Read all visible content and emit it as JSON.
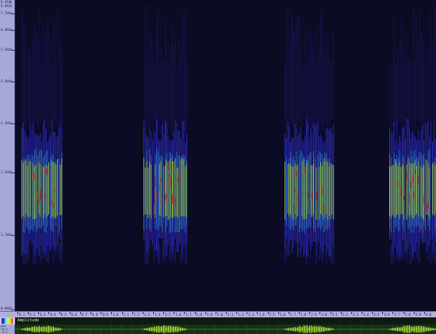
{
  "freq_axis": {
    "labels": [
      "8.910k",
      "8.8kHz",
      "7.7kHz",
      "6.6kHz",
      "5.5kHz",
      "4.4kHz",
      "3.3kHz",
      "2.2kHz",
      "1.1kHz",
      "0.0kHz"
    ]
  },
  "time_axis": {
    "labels": [
      "0.1",
      "0.2",
      "0.3",
      "0.4",
      "0.5",
      "0.6",
      "0.7",
      "0.8",
      "0.9",
      "1.0",
      "1.1",
      "1.2",
      "1.3",
      "1.4",
      "1.5",
      "1.6",
      "1.7",
      "1.8",
      "1.9",
      "2.0",
      "2.1",
      "2.2",
      "2.3",
      "2.4",
      "2.5",
      "2.6",
      "2.7",
      "2.8",
      "2.9",
      "3.0",
      "3.1",
      "3.2",
      "3.3",
      "3.4",
      "3.5",
      "3.6",
      "3.7",
      "3.8",
      "3.9",
      "4.0"
    ]
  },
  "track": {
    "label": "Amplitude"
  },
  "wave_axis": {
    "labels": [
      "pkt",
      "+0.1",
      "-0.1"
    ]
  },
  "colors": {
    "background": "#0c0b24",
    "axis_panel": "#a8a8d8",
    "waveform": "#c8ff40",
    "waveform_bg": "#153015",
    "hot": "#ff2020",
    "warm": "#c8ff40",
    "cool": "#3a3aff"
  }
}
